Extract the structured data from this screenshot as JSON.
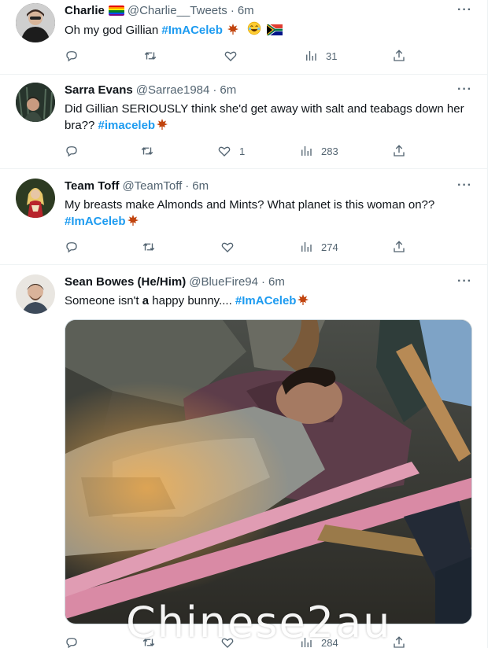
{
  "tweets": [
    {
      "name": "Charlie",
      "name_emoji": "rainbow-flag",
      "handle": "@Charlie__Tweets",
      "time": "6m",
      "text_before": "Oh my god Gillian ",
      "hashtag": "#ImACeleb",
      "text_after": "",
      "emojis": [
        "maple-leaf-icon",
        "laughing-face-icon",
        "south-africa-flag-icon"
      ],
      "replies": "",
      "retweets": "",
      "likes": "",
      "views": "31"
    },
    {
      "name": "Sarra Evans",
      "handle": "@Sarrae1984",
      "time": "6m",
      "text_before": "Did Gillian SERIOUSLY think she'd get away with salt and teabags down her bra?? ",
      "hashtag": "#imaceleb",
      "text_after": "",
      "emojis": [
        "maple-leaf-icon"
      ],
      "replies": "",
      "retweets": "",
      "likes": "1",
      "views": "283"
    },
    {
      "name": "Team Toff",
      "handle": "@TeamToff",
      "time": "6m",
      "text_before": "My breasts make Almonds and  Mints? What planet is this woman on??",
      "hashtag": "#ImACeleb",
      "text_after": "",
      "emojis": [
        "maple-leaf-icon"
      ],
      "replies": "",
      "retweets": "",
      "likes": "",
      "views": "274"
    },
    {
      "name": "Sean Bowes (He/Him)",
      "handle": "@BlueFire94",
      "time": "6m",
      "text_before": "Someone isn't ",
      "text_bold": "a",
      "text_mid": " happy bunny.... ",
      "hashtag": "#ImACeleb",
      "text_after": "",
      "emojis": [
        "maple-leaf-icon"
      ],
      "replies": "",
      "retweets": "",
      "likes": "",
      "views": "284"
    }
  ],
  "more_label": "···",
  "watermark": "Chinese2au",
  "colors": {
    "hashtag": "#1d9bf0",
    "secondary_text": "#536471",
    "divider": "#eff3f4"
  }
}
